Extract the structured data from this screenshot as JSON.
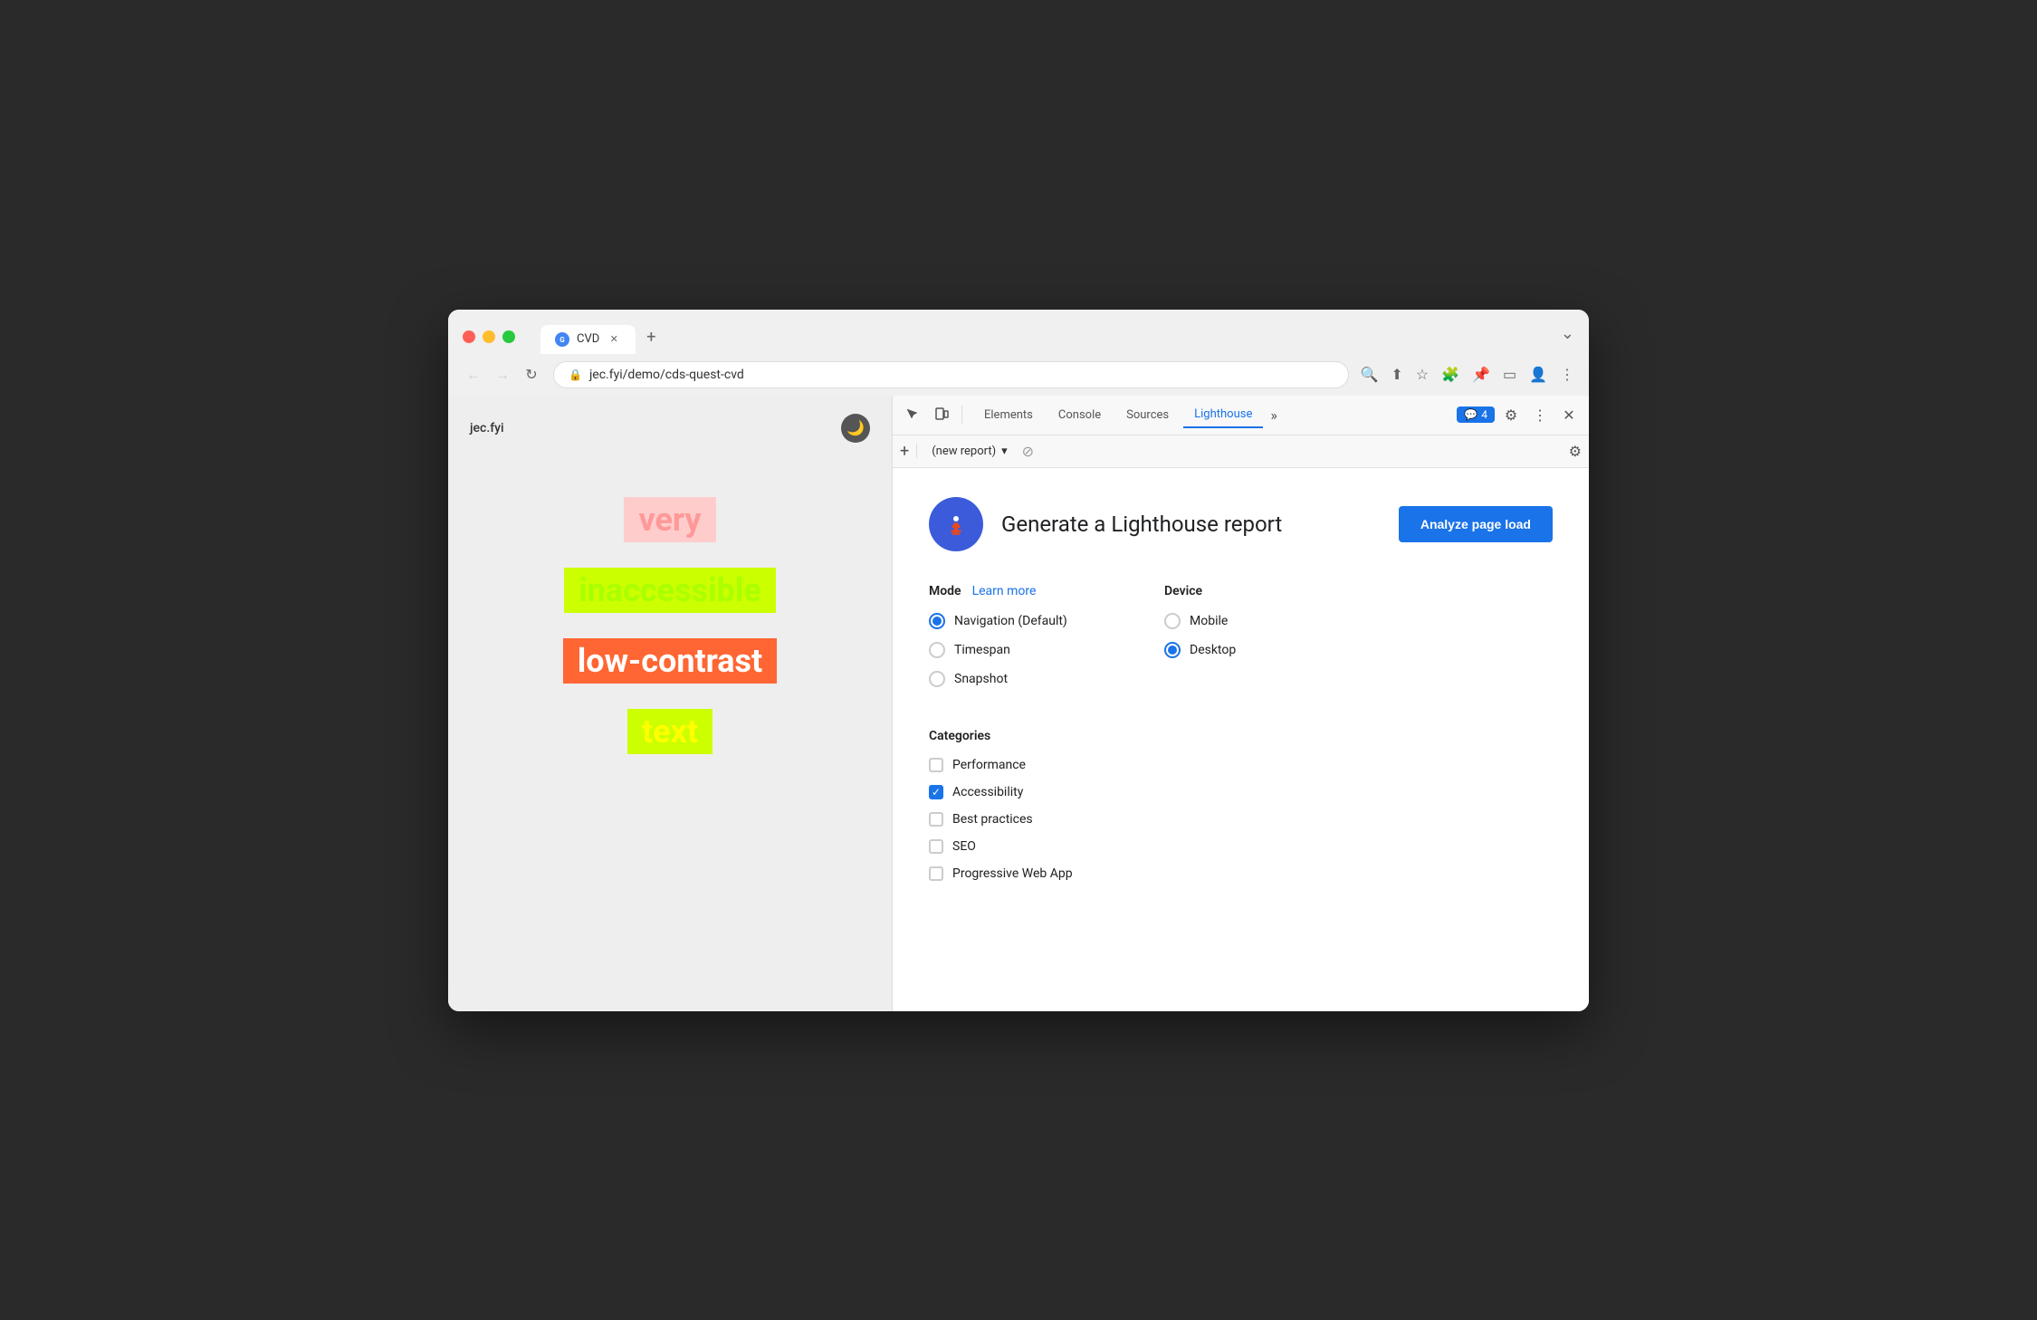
{
  "browser": {
    "traffic_lights": [
      "red",
      "yellow",
      "green"
    ],
    "tab": {
      "label": "CVD",
      "favicon_text": "🌐"
    },
    "tab_new_label": "+",
    "tab_bar_right_label": "⌄",
    "address": {
      "url": "jec.fyi/demo/cds-quest-cvd",
      "lock_icon": "🔒"
    },
    "nav": {
      "back": "←",
      "forward": "→",
      "refresh": "↻"
    },
    "address_icons": [
      "🔍",
      "⬆",
      "☆",
      "🧩",
      "👤",
      "⋮"
    ]
  },
  "website": {
    "title": "jec.fyi",
    "dark_mode_icon": "🌙",
    "words": [
      {
        "text": "very",
        "class": "word-very"
      },
      {
        "text": "inaccessible",
        "class": "word-inaccessible"
      },
      {
        "text": "low-contrast",
        "class": "word-low-contrast"
      },
      {
        "text": "text",
        "class": "word-text"
      }
    ]
  },
  "devtools": {
    "icons": {
      "cursor": "↖",
      "device": "⬜"
    },
    "tabs": [
      {
        "label": "Elements",
        "active": false
      },
      {
        "label": "Console",
        "active": false
      },
      {
        "label": "Sources",
        "active": false
      },
      {
        "label": "Lighthouse",
        "active": true
      }
    ],
    "more_tabs_label": "»",
    "badge_icon": "💬",
    "badge_count": "4",
    "header_icons": {
      "settings": "⚙",
      "more": "⋮",
      "close": "✕"
    },
    "toolbar": {
      "add": "+",
      "report_placeholder": "(new report)",
      "dropdown_icon": "▾",
      "no_entry_icon": "⊘",
      "settings_icon": "⚙"
    },
    "lighthouse": {
      "title": "Generate a Lighthouse report",
      "analyze_btn": "Analyze page load",
      "mode_label": "Mode",
      "learn_more_label": "Learn more",
      "device_label": "Device",
      "modes": [
        {
          "label": "Navigation (Default)",
          "selected": true
        },
        {
          "label": "Timespan",
          "selected": false
        },
        {
          "label": "Snapshot",
          "selected": false
        }
      ],
      "devices": [
        {
          "label": "Mobile",
          "selected": false
        },
        {
          "label": "Desktop",
          "selected": true
        }
      ],
      "categories_label": "Categories",
      "categories": [
        {
          "label": "Performance",
          "checked": false
        },
        {
          "label": "Accessibility",
          "checked": true
        },
        {
          "label": "Best practices",
          "checked": false
        },
        {
          "label": "SEO",
          "checked": false
        },
        {
          "label": "Progressive Web App",
          "checked": false
        }
      ]
    }
  }
}
